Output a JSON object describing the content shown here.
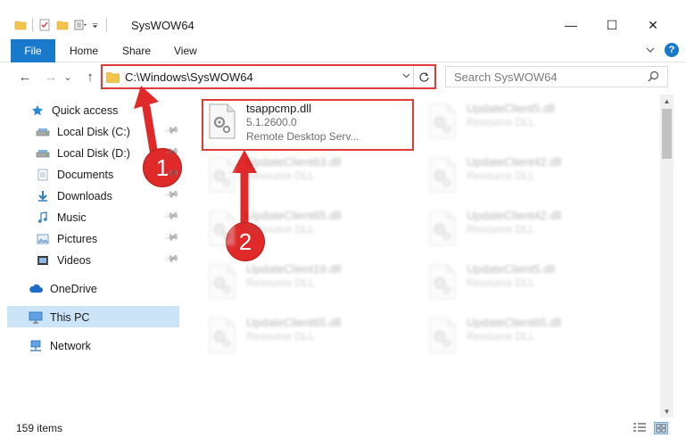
{
  "window": {
    "title": "SysWOW64",
    "controls": {
      "minimize": "—",
      "maximize": "☐",
      "close": "✕"
    }
  },
  "ribbon": {
    "tabs": [
      "File",
      "Home",
      "Share",
      "View"
    ],
    "help_icon": "?"
  },
  "address": {
    "path": "C:\\Windows\\SysWOW64",
    "dropdown_icon": "chevron-down-icon",
    "refresh_icon": "refresh-icon"
  },
  "search": {
    "placeholder": "Search SysWOW64"
  },
  "nav_arrows": {
    "back": "←",
    "forward": "→",
    "recent": "⌄",
    "up": "↑"
  },
  "sidebar": {
    "items": [
      {
        "label": "Quick access",
        "icon": "star-icon",
        "pinned": false
      },
      {
        "label": "Local Disk (C:)",
        "icon": "drive-icon",
        "pinned": true
      },
      {
        "label": "Local Disk (D:)",
        "icon": "drive-icon",
        "pinned": true
      },
      {
        "label": "Documents",
        "icon": "documents-icon",
        "pinned": true
      },
      {
        "label": "Downloads",
        "icon": "downloads-icon",
        "pinned": true
      },
      {
        "label": "Music",
        "icon": "music-icon",
        "pinned": true
      },
      {
        "label": "Pictures",
        "icon": "pictures-icon",
        "pinned": true
      },
      {
        "label": "Videos",
        "icon": "videos-icon",
        "pinned": true
      },
      {
        "label": "OneDrive",
        "icon": "cloud-icon",
        "pinned": false
      },
      {
        "label": "This PC",
        "icon": "computer-icon",
        "pinned": false,
        "selected": true
      },
      {
        "label": "Network",
        "icon": "network-icon",
        "pinned": false
      }
    ]
  },
  "files": {
    "highlighted": {
      "name": "tsappcmp.dll",
      "version": "5.1.2600.0",
      "description": "Remote Desktop Serv..."
    },
    "others": [
      {
        "name": "UpdateClient5.dll",
        "type": "Resource DLL"
      },
      {
        "name": "UpdateClient63.dll",
        "type": "Resource DLL"
      },
      {
        "name": "UpdateClient42.dll",
        "type": "Resource DLL"
      },
      {
        "name": "UpdateClient65.dll",
        "type": "Resource DLL"
      },
      {
        "name": "UpdateClient42.dll",
        "type": "Resource DLL"
      },
      {
        "name": "UpdateClient19.dll",
        "type": "Resource DLL"
      },
      {
        "name": "UpdateClient5.dll",
        "type": "Resource DLL"
      },
      {
        "name": "UpdateClient65.dll",
        "type": "Resource DLL"
      },
      {
        "name": "UpdateClient65.dll",
        "type": "Resource DLL"
      }
    ]
  },
  "status": {
    "item_count": "159 items"
  },
  "callouts": {
    "one": "1",
    "two": "2"
  },
  "colors": {
    "accent": "#1979ca",
    "callout_red": "#e02a2a",
    "selected_bg": "#cce4f7"
  }
}
